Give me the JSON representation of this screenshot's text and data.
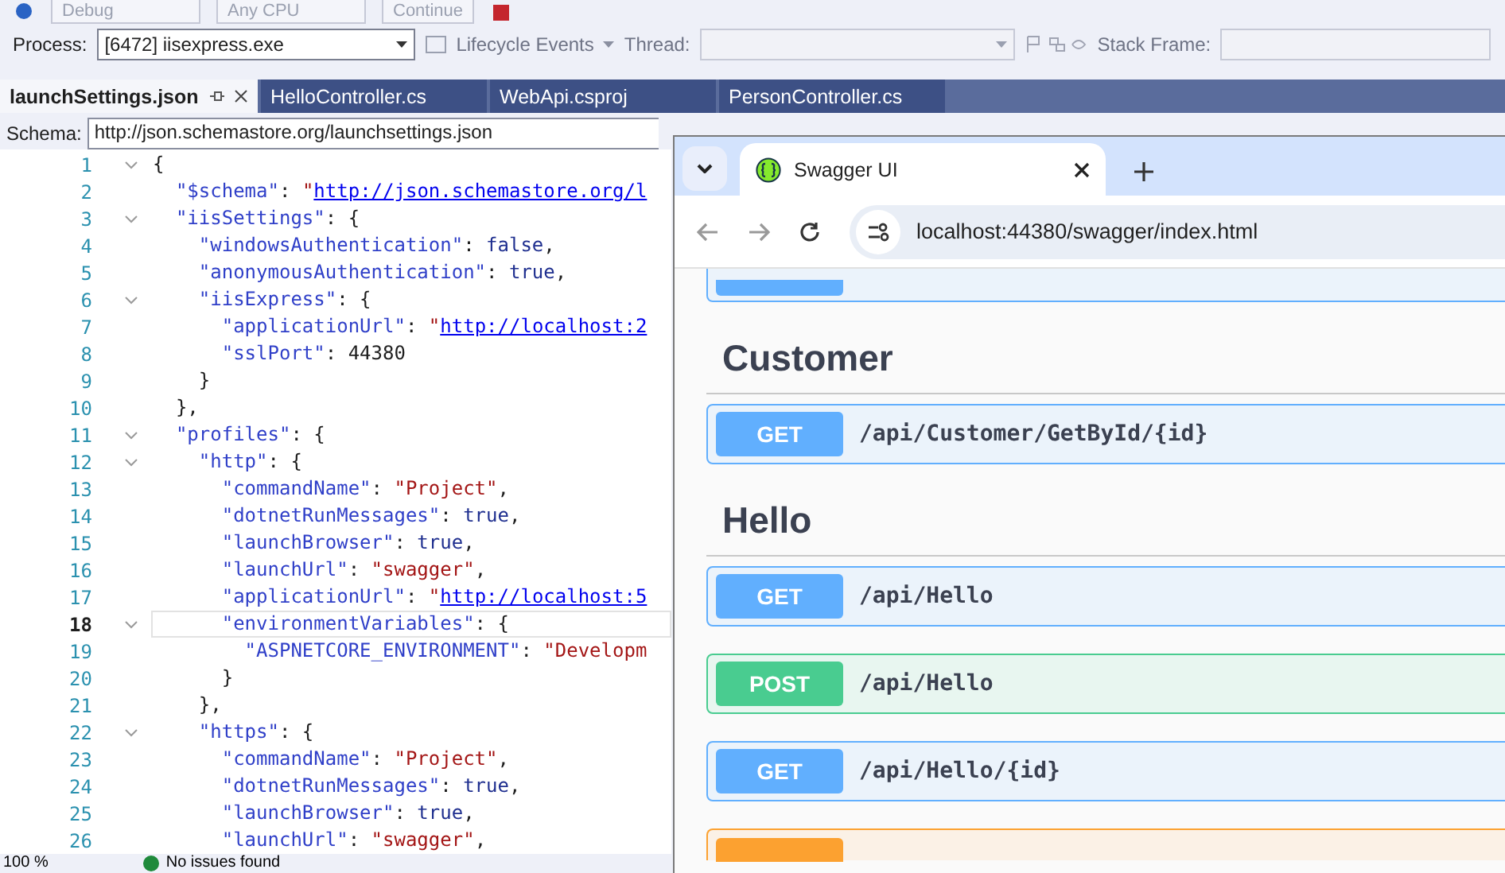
{
  "toolbar_top": {
    "items": [
      "Debug",
      "Any CPU",
      "Continue"
    ]
  },
  "debug_bar": {
    "process_label": "Process:",
    "process_value": "[6472] iisexpress.exe",
    "lifecycle": "Lifecycle Events",
    "thread_label": "Thread:",
    "stack_label": "Stack Frame:"
  },
  "tabs": [
    {
      "label": "launchSettings.json",
      "selected": true
    },
    {
      "label": "HelloController.cs",
      "selected": false
    },
    {
      "label": "WebApi.csproj",
      "selected": false
    },
    {
      "label": "PersonController.cs",
      "selected": false
    }
  ],
  "schema": {
    "label": "Schema:",
    "value": "http://json.schemastore.org/launchsettings.json"
  },
  "lines": [
    {
      "number": "1",
      "fold": true,
      "current": false,
      "tokens": [
        {
          "kind": "punct",
          "text": "{"
        }
      ]
    },
    {
      "number": "2",
      "fold": false,
      "current": false,
      "tokens": [
        {
          "kind": "key",
          "text": "  \"$schema\""
        },
        {
          "kind": "punct",
          "text": ": "
        },
        {
          "kind": "string",
          "text": "\""
        },
        {
          "kind": "link",
          "text": "http://json.schemastore.org/l"
        }
      ]
    },
    {
      "number": "3",
      "fold": true,
      "current": false,
      "tokens": [
        {
          "kind": "key",
          "text": "  \"iisSettings\""
        },
        {
          "kind": "punct",
          "text": ": {"
        }
      ]
    },
    {
      "number": "4",
      "fold": false,
      "current": false,
      "tokens": [
        {
          "kind": "key",
          "text": "    \"windowsAuthentication\""
        },
        {
          "kind": "punct",
          "text": ": "
        },
        {
          "kind": "bool",
          "text": "false"
        },
        {
          "kind": "punct",
          "text": ","
        }
      ]
    },
    {
      "number": "5",
      "fold": false,
      "current": false,
      "tokens": [
        {
          "kind": "key",
          "text": "    \"anonymousAuthentication\""
        },
        {
          "kind": "punct",
          "text": ": "
        },
        {
          "kind": "bool",
          "text": "true"
        },
        {
          "kind": "punct",
          "text": ","
        }
      ]
    },
    {
      "number": "6",
      "fold": true,
      "current": false,
      "tokens": [
        {
          "kind": "key",
          "text": "    \"iisExpress\""
        },
        {
          "kind": "punct",
          "text": ": {"
        }
      ]
    },
    {
      "number": "7",
      "fold": false,
      "current": false,
      "tokens": [
        {
          "kind": "key",
          "text": "      \"applicationUrl\""
        },
        {
          "kind": "punct",
          "text": ": "
        },
        {
          "kind": "string",
          "text": "\""
        },
        {
          "kind": "link",
          "text": "http://localhost:2"
        }
      ]
    },
    {
      "number": "8",
      "fold": false,
      "current": false,
      "tokens": [
        {
          "kind": "key",
          "text": "      \"sslPort\""
        },
        {
          "kind": "punct",
          "text": ": "
        },
        {
          "kind": "number",
          "text": "44380"
        }
      ]
    },
    {
      "number": "9",
      "fold": false,
      "current": false,
      "tokens": [
        {
          "kind": "punct",
          "text": "    }"
        }
      ]
    },
    {
      "number": "10",
      "fold": false,
      "current": false,
      "tokens": [
        {
          "kind": "punct",
          "text": "  },"
        }
      ]
    },
    {
      "number": "11",
      "fold": true,
      "current": false,
      "tokens": [
        {
          "kind": "key",
          "text": "  \"profiles\""
        },
        {
          "kind": "punct",
          "text": ": {"
        }
      ]
    },
    {
      "number": "12",
      "fold": true,
      "current": false,
      "tokens": [
        {
          "kind": "key",
          "text": "    \"http\""
        },
        {
          "kind": "punct",
          "text": ": {"
        }
      ]
    },
    {
      "number": "13",
      "fold": false,
      "current": false,
      "tokens": [
        {
          "kind": "key",
          "text": "      \"commandName\""
        },
        {
          "kind": "punct",
          "text": ": "
        },
        {
          "kind": "string",
          "text": "\"Project\""
        },
        {
          "kind": "punct",
          "text": ","
        }
      ]
    },
    {
      "number": "14",
      "fold": false,
      "current": false,
      "tokens": [
        {
          "kind": "key",
          "text": "      \"dotnetRunMessages\""
        },
        {
          "kind": "punct",
          "text": ": "
        },
        {
          "kind": "bool",
          "text": "true"
        },
        {
          "kind": "punct",
          "text": ","
        }
      ]
    },
    {
      "number": "15",
      "fold": false,
      "current": false,
      "tokens": [
        {
          "kind": "key",
          "text": "      \"launchBrowser\""
        },
        {
          "kind": "punct",
          "text": ": "
        },
        {
          "kind": "bool",
          "text": "true"
        },
        {
          "kind": "punct",
          "text": ","
        }
      ]
    },
    {
      "number": "16",
      "fold": false,
      "current": false,
      "tokens": [
        {
          "kind": "key",
          "text": "      \"launchUrl\""
        },
        {
          "kind": "punct",
          "text": ": "
        },
        {
          "kind": "string",
          "text": "\"swagger\""
        },
        {
          "kind": "punct",
          "text": ","
        }
      ]
    },
    {
      "number": "17",
      "fold": false,
      "current": false,
      "tokens": [
        {
          "kind": "key",
          "text": "      \"applicationUrl\""
        },
        {
          "kind": "punct",
          "text": ": "
        },
        {
          "kind": "string",
          "text": "\""
        },
        {
          "kind": "link",
          "text": "http://localhost:5"
        }
      ]
    },
    {
      "number": "18",
      "fold": true,
      "current": true,
      "tokens": [
        {
          "kind": "key",
          "text": "      \"environmentVariables\""
        },
        {
          "kind": "punct",
          "text": ": {"
        }
      ]
    },
    {
      "number": "19",
      "fold": false,
      "current": false,
      "tokens": [
        {
          "kind": "key",
          "text": "        \"ASPNETCORE_ENVIRONMENT\""
        },
        {
          "kind": "punct",
          "text": ": "
        },
        {
          "kind": "string",
          "text": "\"Developm"
        }
      ]
    },
    {
      "number": "20",
      "fold": false,
      "current": false,
      "tokens": [
        {
          "kind": "punct",
          "text": "      }"
        }
      ]
    },
    {
      "number": "21",
      "fold": false,
      "current": false,
      "tokens": [
        {
          "kind": "punct",
          "text": "    },"
        }
      ]
    },
    {
      "number": "22",
      "fold": true,
      "current": false,
      "tokens": [
        {
          "kind": "key",
          "text": "    \"https\""
        },
        {
          "kind": "punct",
          "text": ": {"
        }
      ]
    },
    {
      "number": "23",
      "fold": false,
      "current": false,
      "tokens": [
        {
          "kind": "key",
          "text": "      \"commandName\""
        },
        {
          "kind": "punct",
          "text": ": "
        },
        {
          "kind": "string",
          "text": "\"Project\""
        },
        {
          "kind": "punct",
          "text": ","
        }
      ]
    },
    {
      "number": "24",
      "fold": false,
      "current": false,
      "tokens": [
        {
          "kind": "key",
          "text": "      \"dotnetRunMessages\""
        },
        {
          "kind": "punct",
          "text": ": "
        },
        {
          "kind": "bool",
          "text": "true"
        },
        {
          "kind": "punct",
          "text": ","
        }
      ]
    },
    {
      "number": "25",
      "fold": false,
      "current": false,
      "tokens": [
        {
          "kind": "key",
          "text": "      \"launchBrowser\""
        },
        {
          "kind": "punct",
          "text": ": "
        },
        {
          "kind": "bool",
          "text": "true"
        },
        {
          "kind": "punct",
          "text": ","
        }
      ]
    },
    {
      "number": "26",
      "fold": false,
      "current": false,
      "tokens": [
        {
          "kind": "key",
          "text": "      \"launchUrl\""
        },
        {
          "kind": "punct",
          "text": ": "
        },
        {
          "kind": "string",
          "text": "\"swagger\""
        },
        {
          "kind": "punct",
          "text": ","
        }
      ]
    }
  ],
  "status_bar": {
    "zoom": "100 %",
    "issues": "No issues found"
  },
  "browser": {
    "tab_title": "Swagger UI",
    "url": "localhost:44380/swagger/index.html",
    "sections": [
      {
        "title": "Customer",
        "operations": [
          {
            "kind": "get",
            "method": "GET",
            "path": "/api/Customer/GetById/{id}"
          }
        ]
      },
      {
        "title": "Hello",
        "operations": [
          {
            "kind": "get",
            "method": "GET",
            "path": "/api/Hello"
          },
          {
            "kind": "post",
            "method": "POST",
            "path": "/api/Hello"
          },
          {
            "kind": "get",
            "method": "GET",
            "path": "/api/Hello/{id}"
          }
        ]
      }
    ]
  }
}
